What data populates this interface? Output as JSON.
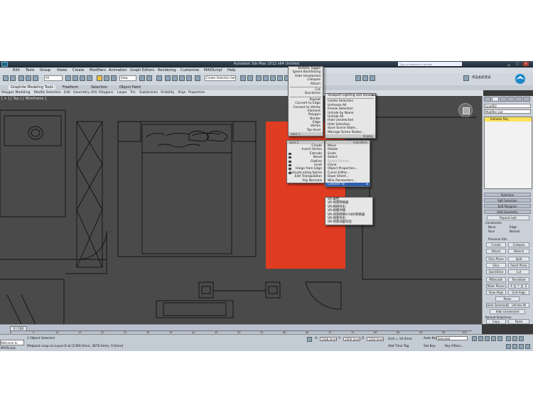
{
  "window": {
    "title": "Autodesk 3ds Max  2012 x64        Untitled",
    "search_placeholder": "Type a keyword or phrase",
    "login_label": "单击此处登录"
  },
  "menubar": [
    "Edit",
    "Tools",
    "Group",
    "Views",
    "Create",
    "Modifiers",
    "Animation",
    "Graph Editors",
    "Rendering",
    "Customize",
    "MAXScript",
    "Help"
  ],
  "toolbar": {
    "filter_value": "All",
    "view_value": "View",
    "selection_set_placeholder": "Create Selection Set"
  },
  "ribbon": {
    "tabs": [
      "Graphite Modeling Tools",
      "Freeform",
      "Selection",
      "Object Paint"
    ],
    "items": [
      "Polygon Modeling",
      "Modify Selection",
      "Edit",
      "Geometry (All)",
      "Polygons",
      "Loops",
      "Tris",
      "Subdivision",
      "Visibility",
      "Align",
      "Properties"
    ]
  },
  "viewport": {
    "label": "[ + ] [ Top ] [ Wireframe ]",
    "accent": "#e03c22"
  },
  "quad_menu": {
    "top_left": [
      "NURMS Toggle",
      "Ignore Backfacing",
      "Hide Unselected",
      "Collapse",
      "Attach",
      "Cut",
      "Quickslice",
      "Repeat",
      "Convert to Edge",
      "Convert to Vertex",
      "Element",
      "Polygon",
      "Border",
      "Edge",
      "Vertex",
      "Top-level"
    ],
    "tools1_header": "tools 1",
    "top_right": [
      "Viewport Lighting and Shadows",
      "Isolate Selection",
      "Unfreeze All",
      "Freeze Selection",
      "Unhide by Name",
      "Unhide All",
      "Hide Unselected",
      "Hide Selection",
      "Save Scene State...",
      "Manage Scene States..."
    ],
    "display_header": "display",
    "tools2_header": "tools 2",
    "bottom_left": [
      "Create",
      "Insert Vertex",
      "Extrude",
      "Bevel",
      "Outline",
      "Inset",
      "Hinge from Edge",
      "Extrude along Spline",
      "Edit Triangulation",
      "Flip Normals"
    ],
    "transform_header": "transform",
    "bottom_right": [
      "Move",
      "Rotate",
      "Scale",
      "Select",
      "Select Similar",
      "Clone",
      "Object Properties...",
      "Curve Editor...",
      "Dope Sheet...",
      "Wire Parameters...",
      "Convert To:"
    ],
    "submenu": [
      "VR-属性",
      "VR-场景转换器",
      "VR-网格导出",
      "VR-帧缓冲器",
      "VR-场景转换V-HDR转换器",
      "VR-场景导出",
      "VR-场景动画导出"
    ]
  },
  "command_panel": {
    "object_name": "Line002",
    "modifier_list": "Modifier List",
    "stack_item": "Editable Poly",
    "rollouts": [
      "Selection",
      "Soft Selection",
      "Edit Polygons",
      "Edit Geometry"
    ],
    "repeat_last": "Repeat Last",
    "constraints_label": "Constraints",
    "constraints": [
      "None",
      "Edge",
      "Face",
      "Normal"
    ],
    "preserve_uvs": "Preserve UVs",
    "buttons": [
      "Create",
      "Collapse",
      "Attach",
      "Detach",
      "Slice Plane",
      "Split",
      "Slice",
      "Reset Plane",
      "QuickSlice",
      "Cut",
      "MSmooth",
      "Tessellate",
      "Make Planar",
      "X",
      "Y",
      "Z",
      "View Align",
      "Grid Align",
      "Relax",
      "Hide Selected",
      "Unhide All",
      "Hide Unselected",
      "Copy",
      "Paste"
    ],
    "named_selections": "Named Selections:"
  },
  "timeline": {
    "slider": "0 / 100",
    "ticks": [
      "0",
      "5",
      "10",
      "15",
      "20",
      "25",
      "30",
      "35",
      "40",
      "45",
      "50",
      "55",
      "60",
      "65",
      "70",
      "75",
      "80",
      "85",
      "90",
      "95",
      "100"
    ]
  },
  "status": {
    "maxscript": "Welcome to MAXScript.",
    "objects_selected": "1 Object Selected",
    "prompt": "Midpoint snap on Layer:0 at [1360.0mm, 3870.0mm, 0.0mm]",
    "x": "2568.0mm",
    "y": "2000.0mm",
    "z": "1200.0mm",
    "grid": "Grid = 10.0mm",
    "add_time_tag": "Add Time Tag",
    "auto_key": "Auto Key",
    "set_key": "Set Key",
    "key_mode": "Selected",
    "key_filters": "Key Filters..."
  }
}
